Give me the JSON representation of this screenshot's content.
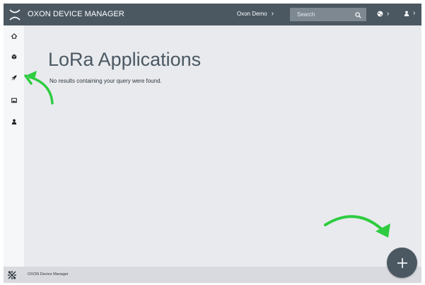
{
  "header": {
    "app_title": "OXON DEVICE MANAGER",
    "tenant": "Oxon Demo",
    "search_placeholder": "Search",
    "language_icon": "globe-icon",
    "user_icon": "user-icon"
  },
  "sidebar": {
    "items": [
      {
        "icon": "home-icon",
        "active": false
      },
      {
        "icon": "devices-icon",
        "active": false
      },
      {
        "icon": "rocket-icon",
        "active": true
      },
      {
        "icon": "image-icon",
        "active": false
      },
      {
        "icon": "user-icon",
        "active": false
      }
    ]
  },
  "main": {
    "title": "LoRa Applications",
    "empty_message": "No results containing your query were found."
  },
  "footer": {
    "label": "OXON Device Manager"
  },
  "fab": {
    "icon": "plus-icon"
  },
  "annotations": {
    "arrow_color": "#2ecc40"
  },
  "colors": {
    "header_bg": "#4b5862",
    "search_bg": "#7d8891",
    "page_bg": "#e8eaee",
    "sidebar_bg": "#f6f7f9",
    "footer_bg": "#d8dadf",
    "fab_bg": "#4b5862"
  }
}
